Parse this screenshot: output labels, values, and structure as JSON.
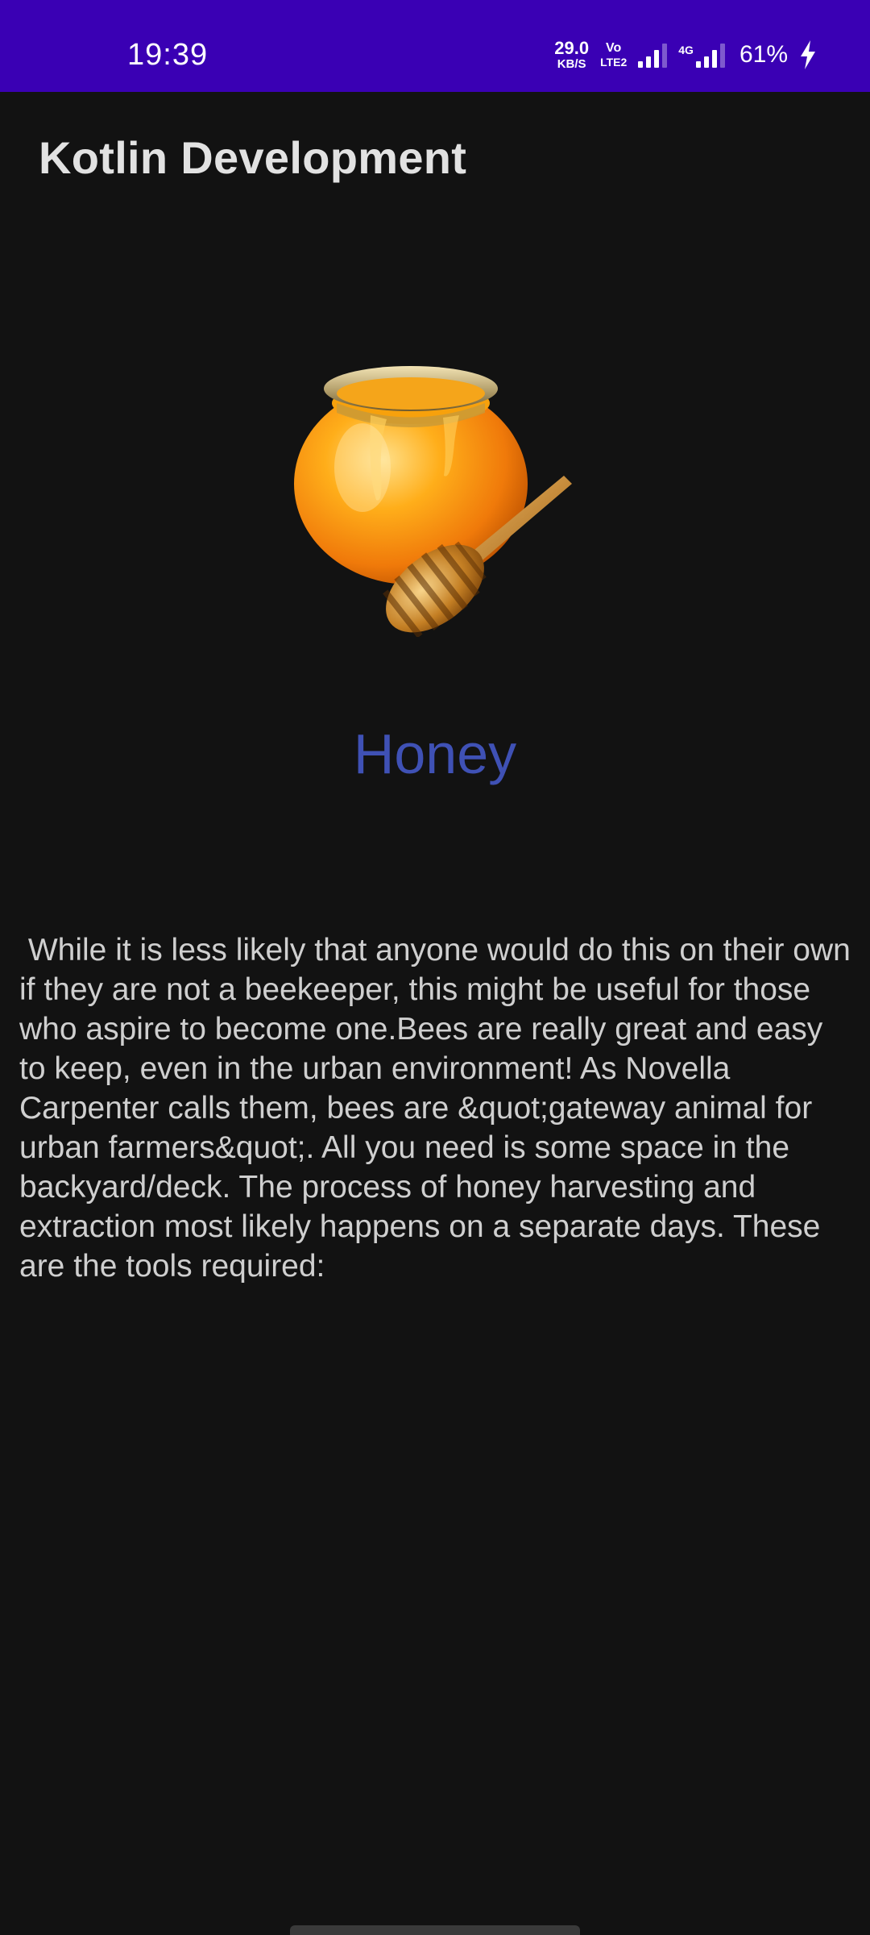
{
  "status_bar": {
    "time": "19:39",
    "net_speed_value": "29.0",
    "net_speed_unit": "KB/S",
    "volte_top": "Vo",
    "volte_bottom": "LTE2",
    "network_label": "4G",
    "battery": "61%",
    "background_color": "#3a00b4"
  },
  "app_bar": {
    "title": "Kotlin Development"
  },
  "content": {
    "image_icon": "honey-pot-icon",
    "title": "Honey",
    "title_color": "#3f51b5",
    "description": " While it is less likely that anyone would do this on their own if they are not a beekeeper, this might be useful for those who aspire to become one.Bees are really great and easy to keep, even in the urban environment! As Novella Carpenter calls them, bees are &quot;gateway animal for urban farmers&quot;. All you need is some space in the backyard/deck. The process of honey harvesting and extraction most likely happens on a separate days. These are the tools required:"
  }
}
